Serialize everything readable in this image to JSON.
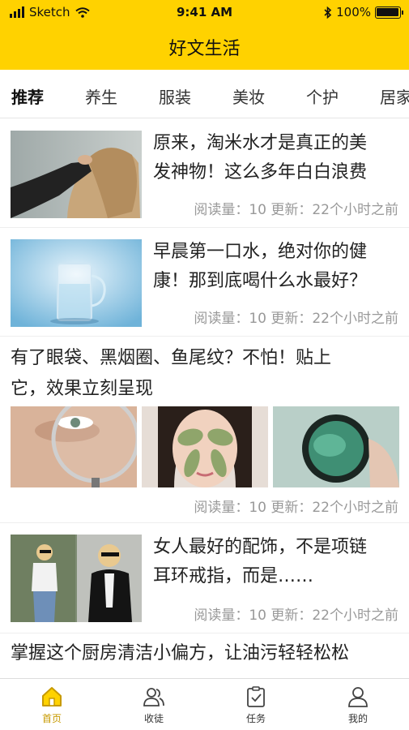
{
  "status_bar": {
    "carrier": "Sketch",
    "time": "9:41 AM",
    "battery_text": "100%",
    "battery_level": 1.0
  },
  "header": {
    "title": "好文生活",
    "background_color": "#FFD200"
  },
  "tabs": [
    {
      "label": "推荐",
      "active": true
    },
    {
      "label": "养生",
      "active": false
    },
    {
      "label": "服装",
      "active": false
    },
    {
      "label": "美妆",
      "active": false
    },
    {
      "label": "个护",
      "active": false
    },
    {
      "label": "居家",
      "active": false
    }
  ],
  "articles": [
    {
      "title_line1": "原来，淘米水才是真正的美",
      "title_line2": "发神物！这么多年白白浪费",
      "meta": "阅读量：10 更新：22个小时之前",
      "image": "woman-hair-photo"
    },
    {
      "title_line1": "早晨第一口水，绝对你的健",
      "title_line2": "康！那到底喝什么水最好？",
      "meta": "阅读量：10 更新：22个小时之前",
      "image": "glass-of-water-photo"
    },
    {
      "title_line1": "有了眼袋、黑烟圈、鱼尾纹？不怕！贴上",
      "title_line2": "它，效果立刻呈现",
      "meta": "阅读量：10 更新：22个小时之前",
      "images": [
        "magnifier-eye-photo",
        "eye-patches-face-photo",
        "eye-patch-jar-photo"
      ]
    },
    {
      "title_line1": "女人最好的配饰，不是项链",
      "title_line2": "耳环戒指，而是……",
      "meta": "阅读量：10 更新：22个小时之前",
      "image": "street-fashion-photo"
    },
    {
      "title_line1": "掌握这个厨房清洁小偏方，让油污轻轻松松",
      "title_line2": "",
      "meta": ""
    }
  ],
  "bottom_nav": [
    {
      "label": "首页",
      "icon": "home-icon",
      "active": true
    },
    {
      "label": "收徒",
      "icon": "users-icon",
      "active": false
    },
    {
      "label": "任务",
      "icon": "task-clipboard-icon",
      "active": false
    },
    {
      "label": "我的",
      "icon": "profile-icon",
      "active": false
    }
  ],
  "colors": {
    "accent": "#FFD200",
    "active_nav": "#C79A00",
    "meta_text": "#999999"
  }
}
